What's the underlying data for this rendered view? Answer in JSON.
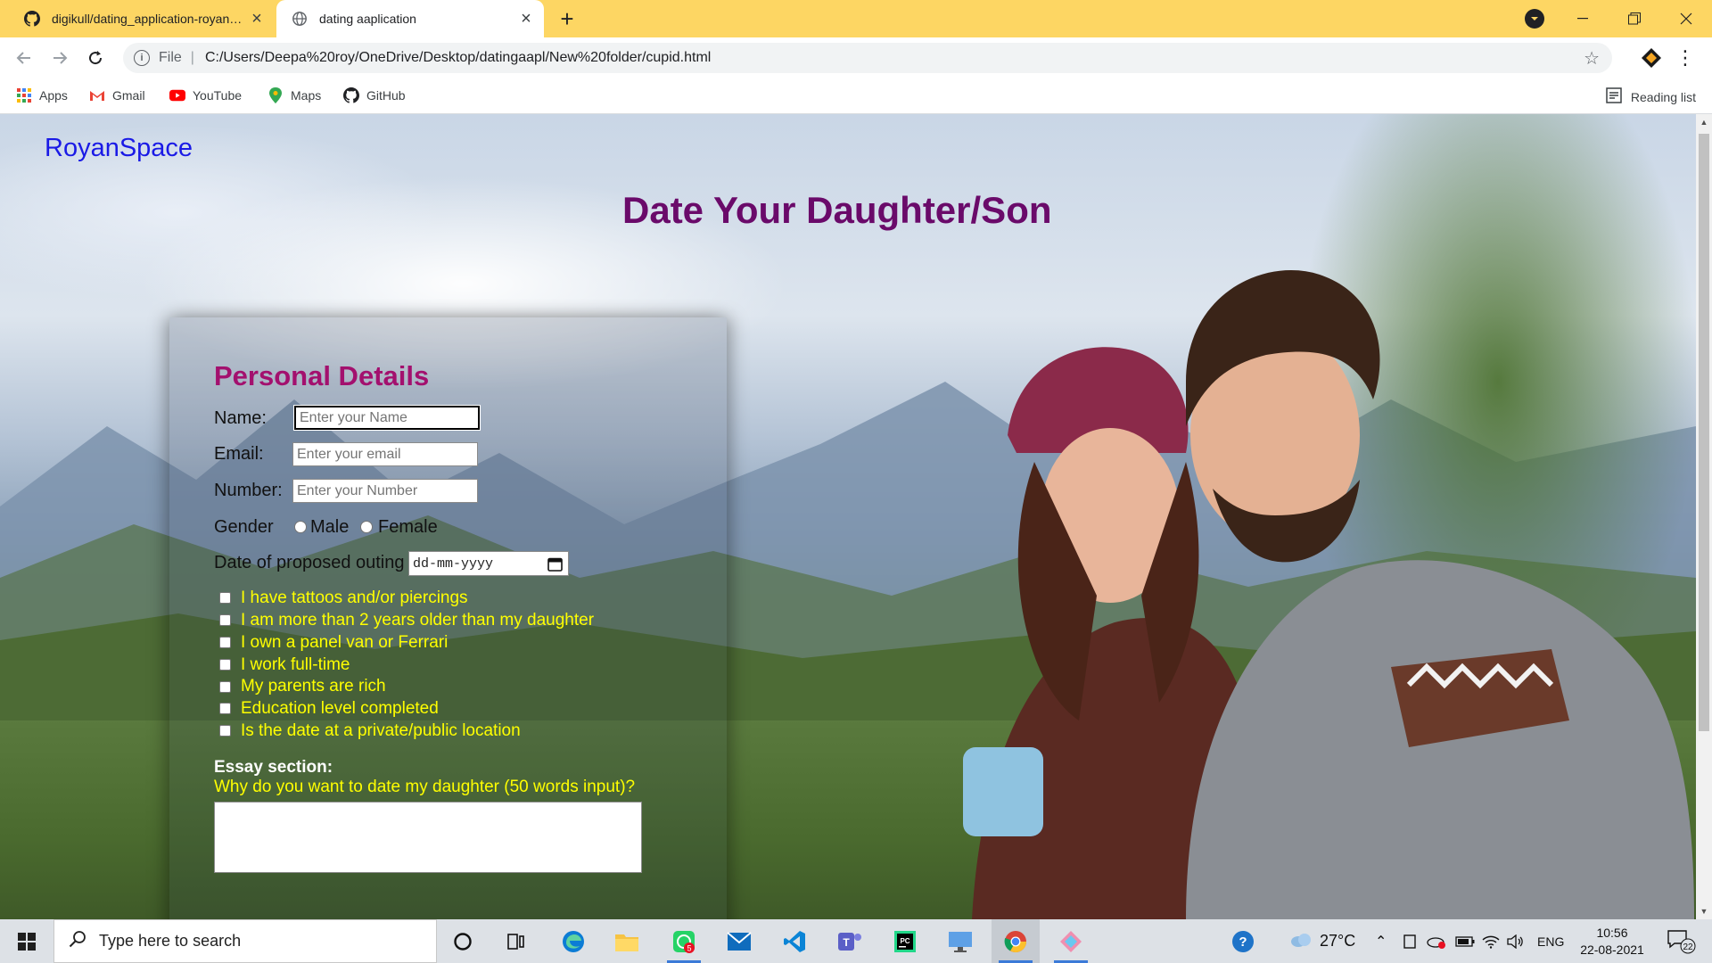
{
  "browser": {
    "tabs": [
      {
        "title": "digikull/dating_application-royanspace",
        "active": false,
        "icon": "github-icon"
      },
      {
        "title": "dating aaplication",
        "active": true,
        "icon": "globe-icon"
      }
    ],
    "address": {
      "scheme": "File",
      "url": "C:/Users/Deepa%20roy/OneDrive/Desktop/datingaapl/New%20folder/cupid.html"
    },
    "bookmarks": [
      {
        "label": "Apps",
        "icon": "apps-grid-icon"
      },
      {
        "label": "Gmail",
        "icon": "gmail-icon"
      },
      {
        "label": "YouTube",
        "icon": "youtube-icon"
      },
      {
        "label": "Maps",
        "icon": "maps-icon"
      },
      {
        "label": "GitHub",
        "icon": "github-icon"
      }
    ],
    "reading_list": "Reading list",
    "accent": "#fdd663"
  },
  "page": {
    "brand": "RoyanSpace",
    "title": "Date Your Daughter/Son",
    "form": {
      "heading": "Personal Details",
      "name_label": "Name:",
      "name_placeholder": "Enter your Name",
      "email_label": "Email:",
      "email_placeholder": "Enter your email",
      "number_label": "Number:",
      "number_placeholder": "Enter your Number",
      "gender_label": "Gender",
      "gender_options": [
        "Male",
        "Female"
      ],
      "date_label": "Date of proposed outing",
      "date_placeholder": "dd-mm-yyyy",
      "checkboxes": [
        "I have tattoos and/or piercings",
        "I am more than 2 years older than my daughter",
        "I own a panel van or Ferrari",
        "I work full-time",
        "My parents are rich",
        "Education level completed",
        "Is the date at a private/public location"
      ],
      "essay_title": "Essay section:",
      "essay_question": "Why do you want to date my daughter (50 words input)?"
    },
    "colors": {
      "brand": "#1a1ae6",
      "title": "#6a0a6a",
      "heading": "#a3106e",
      "checkbox_text": "#ffff00"
    }
  },
  "taskbar": {
    "search_placeholder": "Type here to search",
    "temperature": "27°C",
    "language": "ENG",
    "time": "10:56",
    "date": "22-08-2021",
    "notification_count": "22",
    "whatsapp_badge": "5"
  }
}
